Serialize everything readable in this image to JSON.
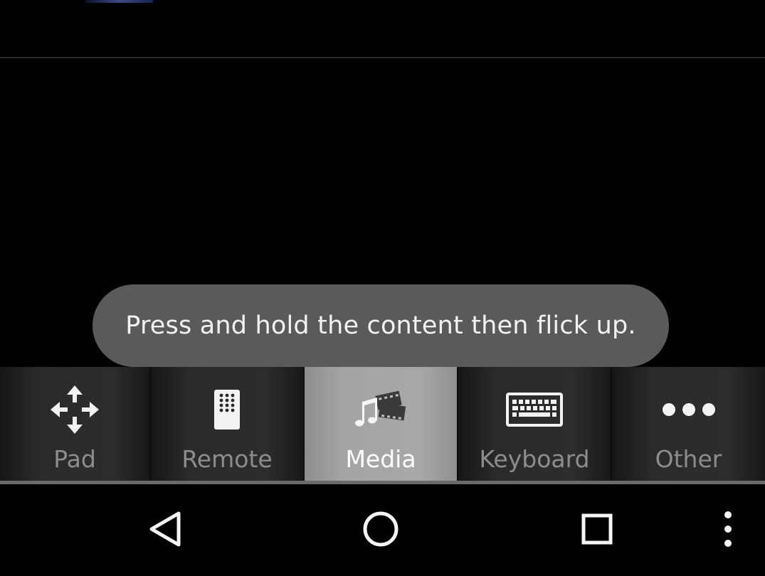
{
  "toast": {
    "message": "Press and hold the content then flick up."
  },
  "tabs": [
    {
      "label": "Pad",
      "icon": "dpad-arrows-icon",
      "active": false
    },
    {
      "label": "Remote",
      "icon": "remote-control-icon",
      "active": false
    },
    {
      "label": "Media",
      "icon": "media-music-film-icon",
      "active": true
    },
    {
      "label": "Keyboard",
      "icon": "keyboard-icon",
      "active": false
    },
    {
      "label": "Other",
      "icon": "more-dots-icon",
      "active": false
    }
  ],
  "navbar": {
    "buttons": [
      {
        "name": "back",
        "icon": "back-triangle-icon"
      },
      {
        "name": "home",
        "icon": "home-circle-icon"
      },
      {
        "name": "recents",
        "icon": "recents-square-icon"
      },
      {
        "name": "menu",
        "icon": "overflow-menu-icon"
      }
    ]
  },
  "colors": {
    "toast_bg": "#5a5a5a",
    "active_tab_bg": "#a4a4a4",
    "inactive_tab_bg": "#2a2a2a",
    "inactive_label": "#8d8d8d"
  }
}
